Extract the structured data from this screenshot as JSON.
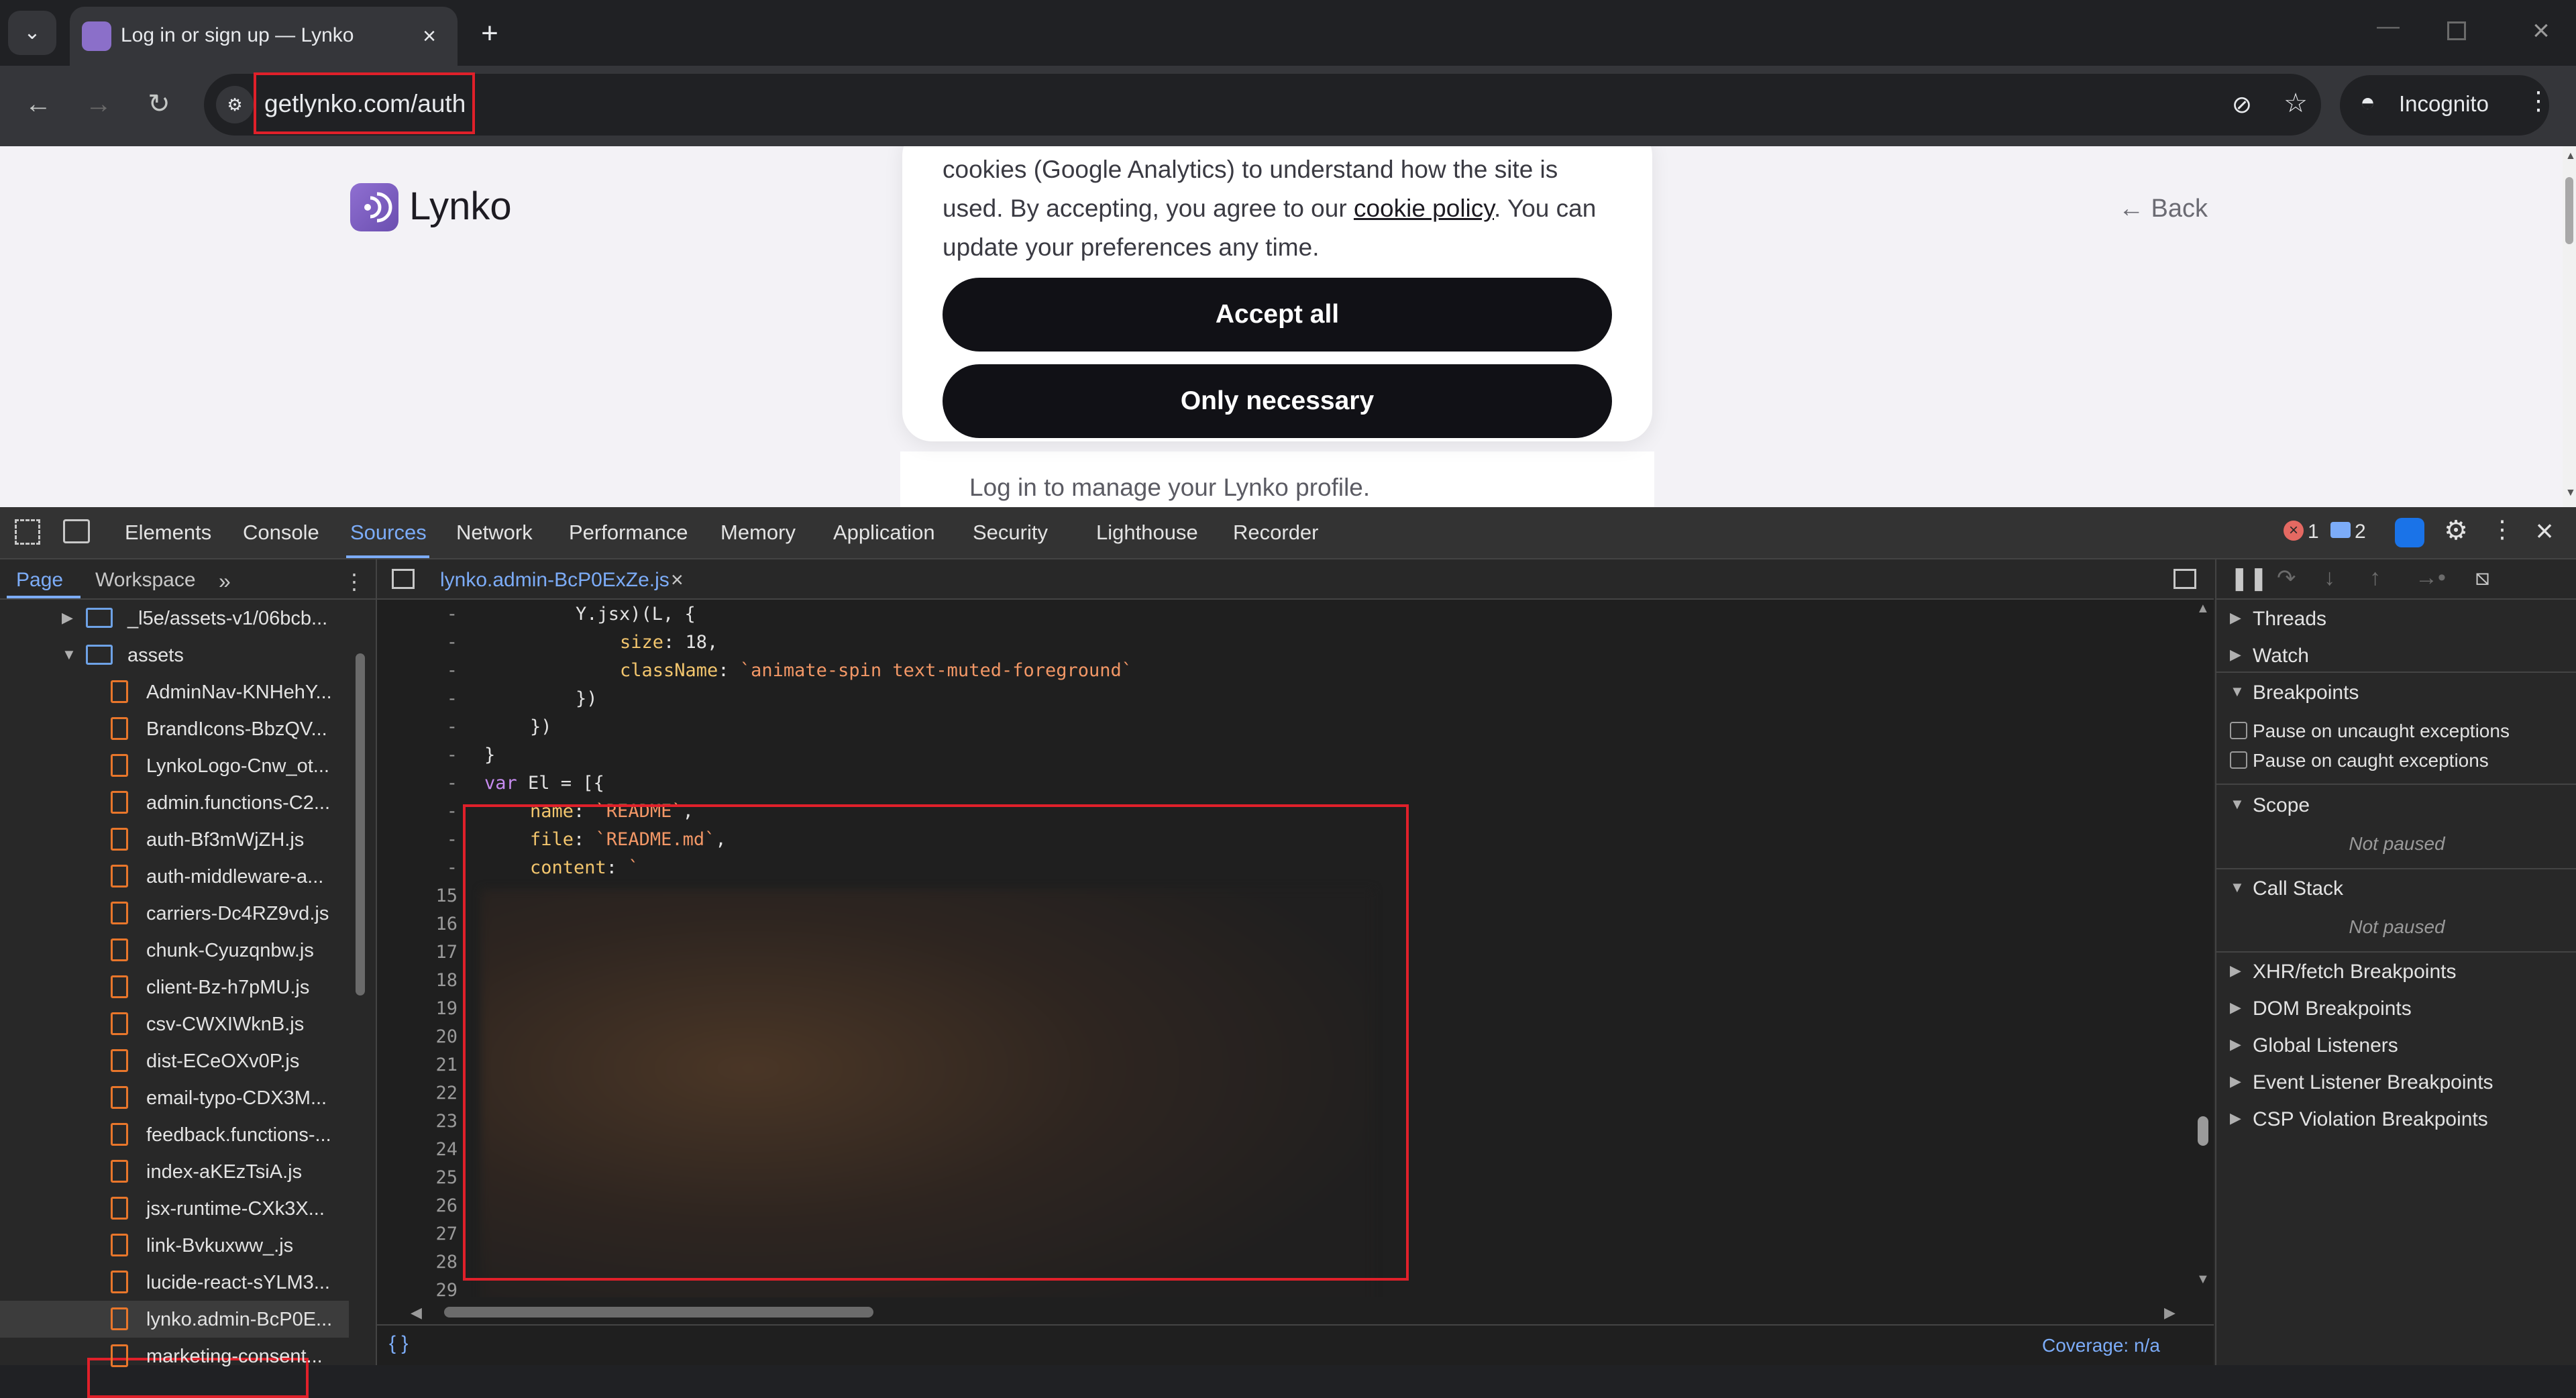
{
  "browser": {
    "tab_title": "Log in or sign up — Lynko",
    "url": "getlynko.com/auth",
    "incognito_label": "Incognito"
  },
  "page": {
    "logo_text": "Lynko",
    "back_label": "← Back",
    "cookie_text_before": "cookies (Google Analytics) to understand how the site is used. By accepting, you agree to our ",
    "cookie_link": "cookie policy",
    "cookie_text_after": ". You can update your preferences any time.",
    "accept_all": "Accept all",
    "only_necessary": "Only necessary",
    "login_subtitle": "Log in to manage your Lynko profile."
  },
  "devtools": {
    "tabs": [
      "Elements",
      "Console",
      "Sources",
      "Network",
      "Performance",
      "Memory",
      "Application",
      "Security",
      "Lighthouse",
      "Recorder"
    ],
    "active_tab": "Sources",
    "error_count": "1",
    "message_count": "2",
    "navigator": {
      "tabs": [
        "Page",
        "Workspace"
      ],
      "folder_collapsed": "_l5e/assets-v1/06bcb...",
      "folder_open": "assets",
      "files": [
        "AdminNav-KNHehY...",
        "BrandIcons-BbzQV...",
        "LynkoLogo-Cnw_ot...",
        "admin.functions-C2...",
        "auth-Bf3mWjZH.js",
        "auth-middleware-a...",
        "carriers-Dc4RZ9vd.js",
        "chunk-Cyuzqnbw.js",
        "client-Bz-h7pMU.js",
        "csv-CWXIWknB.js",
        "dist-ECeOXv0P.js",
        "email-typo-CDX3M...",
        "feedback.functions-...",
        "index-aKEzTsiA.js",
        "jsx-runtime-CXk3X...",
        "link-Bvkuxww_.js",
        "lucide-react-sYLM3...",
        "lynko.admin-BcP0E...",
        "marketing-consent..."
      ]
    },
    "editor": {
      "file_tab": "lynko.admin-BcP0ExZe.js",
      "gutter_dash_count": 10,
      "line_numbers": [
        "15",
        "16",
        "17",
        "18",
        "19",
        "20",
        "21",
        "22",
        "23",
        "24",
        "25",
        "26",
        "27",
        "28",
        "29"
      ],
      "code": {
        "l1": "Y.jsx)(L, {",
        "l2_prop": "size",
        "l2_val": ": 18,",
        "l3_prop": "className",
        "l3_str": "`animate-spin text-muted-foreground`",
        "l4": "})",
        "l5": "})",
        "l6": "}",
        "l7_kw": "var",
        "l7_rest": " El = [{",
        "l8_prop": "name",
        "l8_str": "`README`",
        "l9_prop": "file",
        "l9_str": "`README.md`",
        "l10_prop": "content",
        "l10_str": "`"
      },
      "coverage": "Coverage: n/a",
      "format_label": "{ }"
    },
    "debugger": {
      "threads": "Threads",
      "watch": "Watch",
      "breakpoints": "Breakpoints",
      "pause_uncaught": "Pause on uncaught exceptions",
      "pause_caught": "Pause on caught exceptions",
      "scope": "Scope",
      "not_paused_scope": "Not paused",
      "call_stack": "Call Stack",
      "not_paused_stack": "Not paused",
      "xhr": "XHR/fetch Breakpoints",
      "dom": "DOM Breakpoints",
      "global": "Global Listeners",
      "event": "Event Listener Breakpoints",
      "csp": "CSP Violation Breakpoints"
    }
  },
  "colors": {
    "highlight_red": "#e0202a",
    "devtools_accent": "#7cacf8",
    "file_icon": "#e8762b"
  }
}
